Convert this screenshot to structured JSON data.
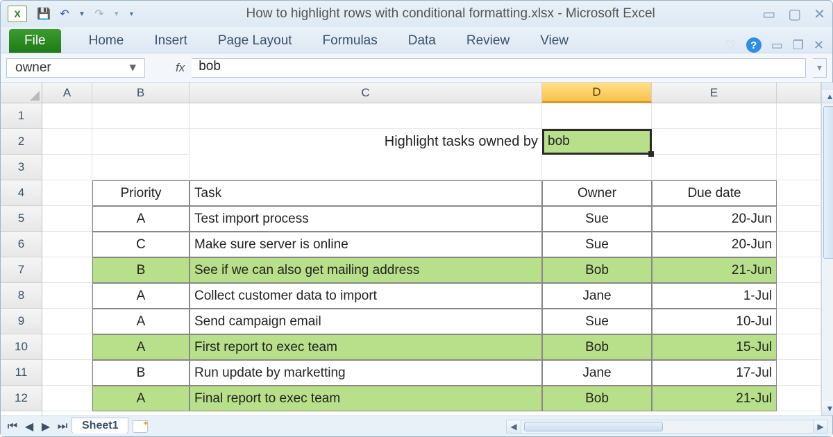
{
  "window": {
    "title": "How to highlight rows with conditional formatting.xlsx - Microsoft Excel",
    "app_icon_letter": "X"
  },
  "qat": {
    "save": "💾",
    "undo": "↶",
    "redo": "↷"
  },
  "tabs": {
    "file": "File",
    "items": [
      "Home",
      "Insert",
      "Page Layout",
      "Formulas",
      "Data",
      "Review",
      "View"
    ]
  },
  "name_box": "owner",
  "formula_bar": {
    "fx": "fx",
    "value": "bob"
  },
  "columns": [
    "A",
    "B",
    "C",
    "D",
    "E",
    ""
  ],
  "selected_column": "D",
  "rows": [
    "1",
    "2",
    "3",
    "4",
    "5",
    "6",
    "7",
    "8",
    "9",
    "10",
    "11",
    "12"
  ],
  "prompt": "Highlight tasks owned by",
  "active_cell_value": "bob",
  "table": {
    "headers": {
      "priority": "Priority",
      "task": "Task",
      "owner": "Owner",
      "due": "Due date"
    },
    "rows": [
      {
        "priority": "A",
        "task": "Test import process",
        "owner": "Sue",
        "due": "20-Jun",
        "hl": false
      },
      {
        "priority": "C",
        "task": "Make sure server is online",
        "owner": "Sue",
        "due": "20-Jun",
        "hl": false
      },
      {
        "priority": "B",
        "task": "See if we can also get mailing address",
        "owner": "Bob",
        "due": "21-Jun",
        "hl": true
      },
      {
        "priority": "A",
        "task": "Collect customer data to import",
        "owner": "Jane",
        "due": "1-Jul",
        "hl": false
      },
      {
        "priority": "A",
        "task": "Send campaign email",
        "owner": "Sue",
        "due": "10-Jul",
        "hl": false
      },
      {
        "priority": "A",
        "task": "First report to exec team",
        "owner": "Bob",
        "due": "15-Jul",
        "hl": true
      },
      {
        "priority": "B",
        "task": "Run update by marketting",
        "owner": "Jane",
        "due": "17-Jul",
        "hl": false
      },
      {
        "priority": "A",
        "task": "Final report to exec team",
        "owner": "Bob",
        "due": "21-Jul",
        "hl": true
      }
    ]
  },
  "sheet_tab": "Sheet1"
}
